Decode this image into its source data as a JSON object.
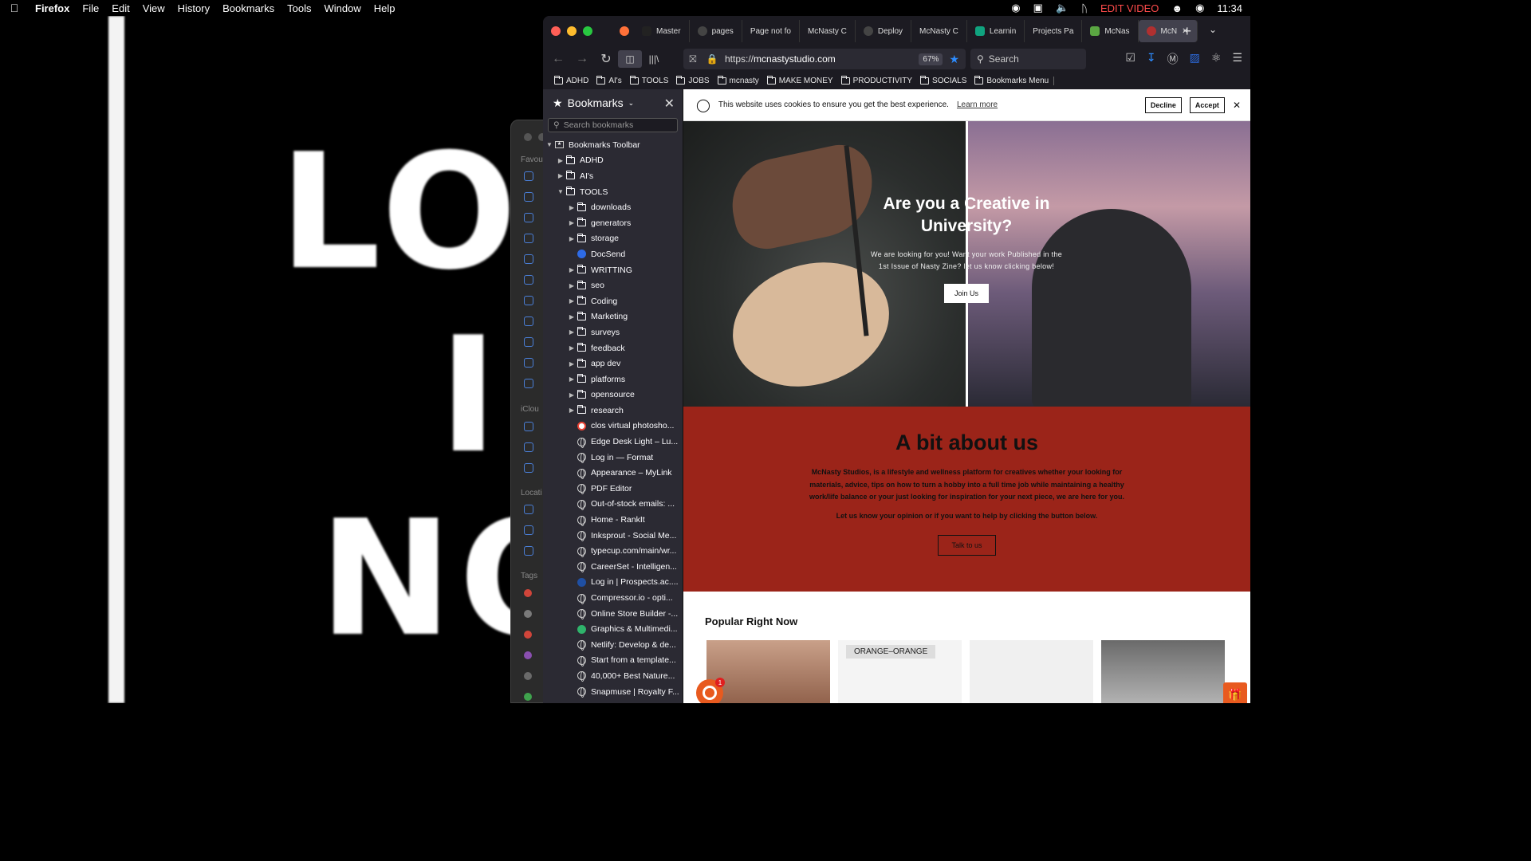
{
  "menubar": {
    "apple": "",
    "app": "Firefox",
    "items": [
      "File",
      "Edit",
      "View",
      "History",
      "Bookmarks",
      "Tools",
      "Window",
      "Help"
    ],
    "edit_video": "EDIT VIDEO",
    "clock": "11:34"
  },
  "background": {
    "word1": "LOG",
    "word2": "I",
    "word3": "NO"
  },
  "finder": {
    "favourites": "Favou",
    "icloud": "iClou",
    "locations": "Locati",
    "tags": "Tags"
  },
  "tabs": [
    {
      "label": "Master",
      "color": "#222222"
    },
    {
      "label": "pages",
      "color": "#444444"
    },
    {
      "label": "Page not fo",
      "color": "#1c1b22"
    },
    {
      "label": "McNasty C",
      "color": "#1c1b22"
    },
    {
      "label": "Deploy",
      "color": "#444444"
    },
    {
      "label": "McNasty C",
      "color": "#1c1b22"
    },
    {
      "label": "Learnin",
      "color": "#10a37f"
    },
    {
      "label": "Projects Pa",
      "color": "#1c1b22"
    },
    {
      "label": "McNas",
      "color": "#5aa642"
    },
    {
      "label": "McN",
      "color": "#b03030"
    }
  ],
  "nav": {
    "url_prefix": "https://",
    "url_host": "mcnastystudio.com",
    "zoom": "67%",
    "search_placeholder": "Search"
  },
  "bookmarks_toolbar": [
    "ADHD",
    "AI's",
    "TOOLS",
    "JOBS",
    "mcnasty",
    "MAKE MONEY",
    "PRODUCTIVITY",
    "SOCIALS",
    "Bookmarks Menu"
  ],
  "sidebar": {
    "title": "Bookmarks",
    "search_placeholder": "Search bookmarks",
    "root": "Bookmarks Toolbar",
    "top_folders": [
      "ADHD",
      "AI's"
    ],
    "open_folder": "TOOLS",
    "tools_children": [
      {
        "label": "downloads",
        "type": "folder"
      },
      {
        "label": "generators",
        "type": "folder"
      },
      {
        "label": "storage",
        "type": "folder"
      },
      {
        "label": "DocSend",
        "type": "link",
        "icon": "docsend"
      },
      {
        "label": "WRITTING",
        "type": "folder"
      },
      {
        "label": "seo",
        "type": "folder"
      },
      {
        "label": "Coding",
        "type": "folder"
      },
      {
        "label": "Marketing",
        "type": "folder"
      },
      {
        "label": "surveys",
        "type": "folder"
      },
      {
        "label": "feedback",
        "type": "folder"
      },
      {
        "label": "app dev",
        "type": "folder"
      },
      {
        "label": "platforms",
        "type": "folder"
      },
      {
        "label": "opensource",
        "type": "folder"
      },
      {
        "label": "research",
        "type": "folder"
      },
      {
        "label": "clos virtual photosho...",
        "type": "link",
        "icon": "google"
      },
      {
        "label": "Edge Desk Light – Lu...",
        "type": "link",
        "icon": "globe"
      },
      {
        "label": "Log in — Format",
        "type": "link",
        "icon": "globe"
      },
      {
        "label": "Appearance – MyLink",
        "type": "link",
        "icon": "globe"
      },
      {
        "label": "PDF Editor",
        "type": "link",
        "icon": "globe"
      },
      {
        "label": "Out-of-stock emails: ...",
        "type": "link",
        "icon": "globe"
      },
      {
        "label": "Home - RankIt",
        "type": "link",
        "icon": "globe"
      },
      {
        "label": "Inksprout - Social Me...",
        "type": "link",
        "icon": "globe"
      },
      {
        "label": "typecup.com/main/wr...",
        "type": "link",
        "icon": "globe"
      },
      {
        "label": "CareerSet - Intelligen...",
        "type": "link",
        "icon": "globe"
      },
      {
        "label": "Log in | Prospects.ac....",
        "type": "link",
        "icon": "prospects"
      },
      {
        "label": "Compressor.io - opti...",
        "type": "link",
        "icon": "globe"
      },
      {
        "label": "Online Store Builder -...",
        "type": "link",
        "icon": "globe"
      },
      {
        "label": "Graphics & Multimedi...",
        "type": "link",
        "icon": "graphics"
      },
      {
        "label": "Netlify: Develop & de...",
        "type": "link",
        "icon": "globe"
      },
      {
        "label": "Start from a template...",
        "type": "link",
        "icon": "globe"
      },
      {
        "label": "40,000+ Best Nature...",
        "type": "link",
        "icon": "globe"
      },
      {
        "label": "Snapmuse | Royalty F...",
        "type": "link",
        "icon": "globe"
      }
    ]
  },
  "page": {
    "cookie_text": "This website uses cookies to ensure you get the best experience.",
    "cookie_learn": "Learn more",
    "cookie_decline": "Decline",
    "cookie_accept": "Accept",
    "hero_title": "Are you a Creative in University?",
    "hero_text": "We are looking for you! Want your work Published in the 1st Issue of Nasty Zine? let us know clicking below!",
    "hero_button": "Join Us",
    "about_title": "A bit about us",
    "about_p1": "McNasty Studios, is a lifestyle and wellness platform for creatives whether your looking for materials, advice, tips on how to turn a hobby into a full time job while maintaining a healthy work/life balance or your just looking for inspiration for your next piece, we are here for you.",
    "about_p2": "Let us know your opinion or if you want to help by clicking the button below.",
    "about_button": "Talk to us",
    "popular_title": "Popular Right Now",
    "product2_label": "ORANGE–ORANGE",
    "chat_badge": "1"
  },
  "colors": {
    "about_bg": "#9b2419",
    "accent_orange": "#e85a1f",
    "ff_chrome": "#1c1b22",
    "star_blue": "#2d8cff"
  }
}
